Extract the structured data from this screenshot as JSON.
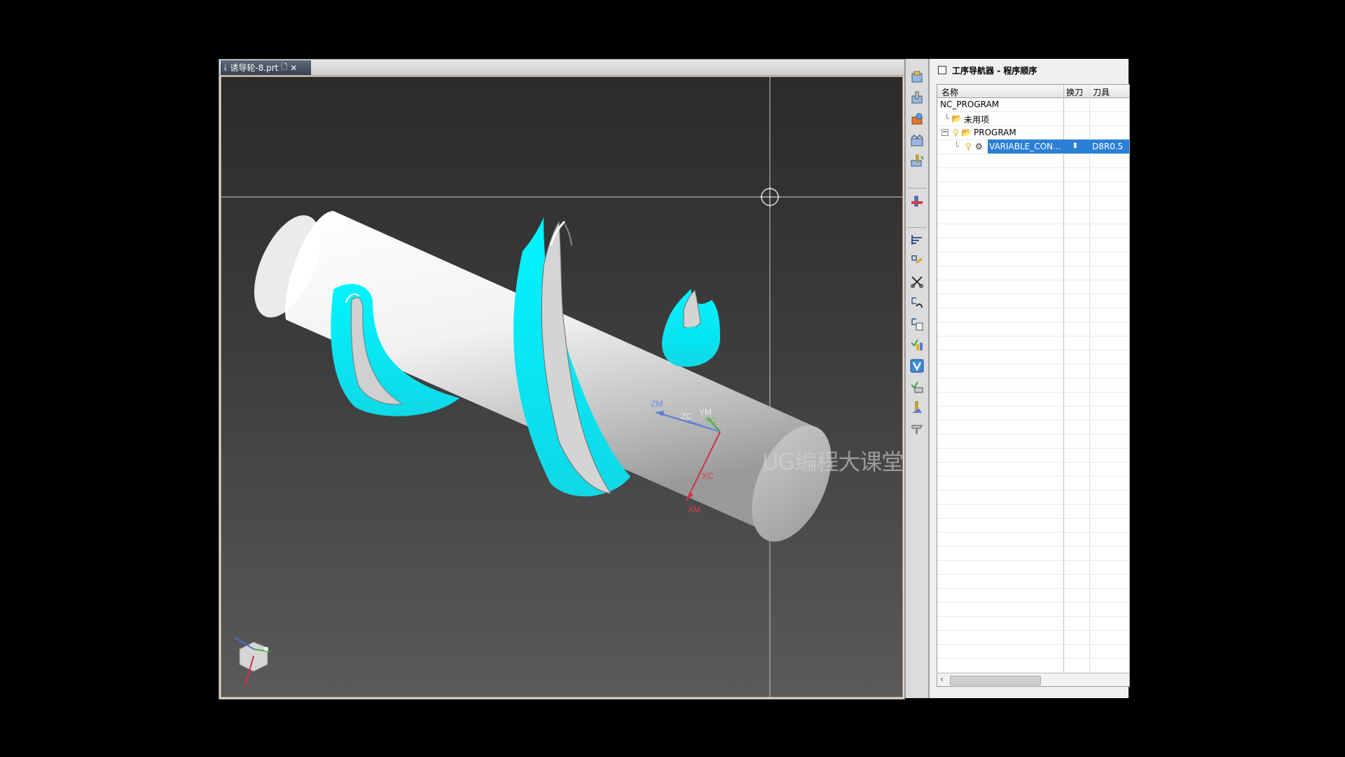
{
  "document": {
    "tab_title": "诱导轮-8.prt",
    "tab_close": "✕"
  },
  "viewport": {
    "watermark": "UG编程大课堂-莫莫",
    "axis_labels": {
      "zm": "ZM",
      "zc": "ZC",
      "ym": "YM",
      "yc": "YC",
      "xc": "XC",
      "xm": "XM"
    },
    "toolpath_color": "#00f0ff",
    "part_color": "#e8e8e8"
  },
  "toolbar": {
    "icons": [
      "create-program-icon",
      "create-tool-icon",
      "create-geometry-icon",
      "create-method-icon",
      "create-operation-icon",
      "edit-object-icon",
      "generate-toolpath-icon",
      "tool-icon",
      "cut-icon",
      "copy-icon",
      "paste-icon",
      "verify-icon",
      "replay-icon",
      "list-icon",
      "postprocess-icon",
      "output-icon"
    ]
  },
  "navigator": {
    "title": "工序导航器 - 程序顺序",
    "columns": {
      "name": "名称",
      "tool_change": "换刀",
      "tool": "刀具"
    },
    "rows": [
      {
        "name": "NC_PROGRAM",
        "tool_change": "",
        "tool": ""
      },
      {
        "name": "未用项",
        "tool_change": "",
        "tool": ""
      },
      {
        "name": "PROGRAM",
        "tool_change": "",
        "tool": ""
      },
      {
        "name": "VARIABLE_CON...",
        "tool_change": "▮",
        "tool": "D8R0.5"
      }
    ]
  }
}
